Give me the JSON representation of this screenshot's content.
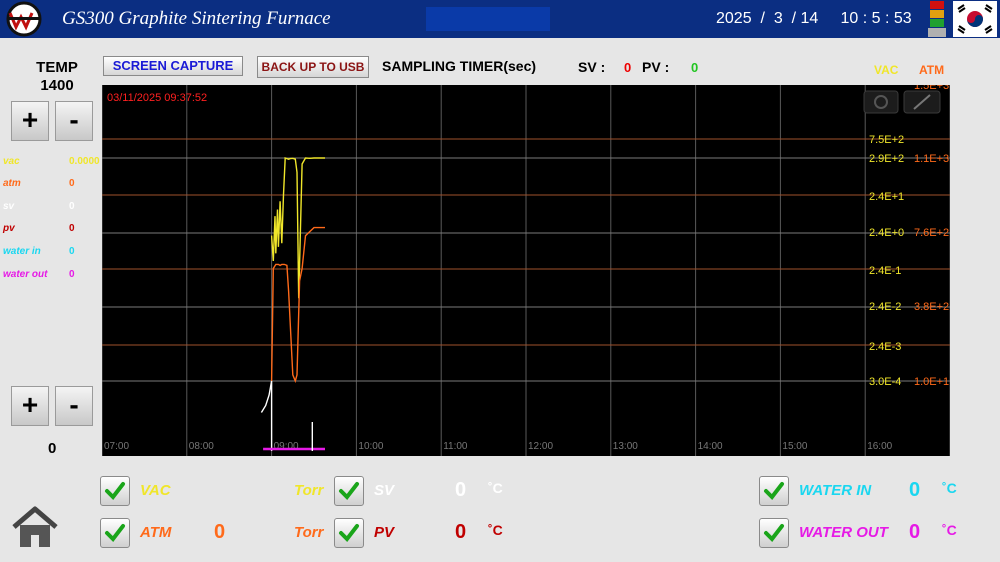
{
  "header": {
    "title": "GS300 Graphite Sintering Furnace",
    "clock": "2025  /  3  / 14     10 : 5 : 53",
    "logo_icon": "company-logo",
    "flag_icon": "korea-flag-icon",
    "tower_icon": "signal-tower-icon"
  },
  "temp": {
    "label": "TEMP",
    "value": "1400"
  },
  "left": {
    "lower_zero": "0"
  },
  "legend": [
    {
      "label": "vac",
      "value": "0.0000",
      "color": "#f0e62a"
    },
    {
      "label": "atm",
      "value": "0",
      "color": "#ff6a1a"
    },
    {
      "label": "sv",
      "value": "0",
      "color": "#ffffff"
    },
    {
      "label": "pv",
      "value": "0",
      "color": "#c00000"
    },
    {
      "label": "water in",
      "value": "0",
      "color": "#1ad7f0"
    },
    {
      "label": "water out",
      "value": "0",
      "color": "#e61ae6"
    }
  ],
  "toolbar": {
    "capture_label": "SCREEN CAPTURE",
    "usb_label": "BACK UP TO USB",
    "sampling_label": "SAMPLING TIMER(sec)",
    "sv_label": "SV :",
    "sv_value": "0",
    "pv_label": "PV :",
    "pv_value": "0",
    "vac_head": "VAC",
    "atm_head": "ATM"
  },
  "chart_data": {
    "type": "line",
    "timestamp": "03/11/2025 09:37:52",
    "x_ticks": [
      "07:00",
      "08:00",
      "09:00",
      "10:00",
      "11:00",
      "12:00",
      "13:00",
      "14:00",
      "15:00",
      "16:00"
    ],
    "vac_ticks": [
      "7.5E+2",
      "2.9E+2",
      "2.4E+1",
      "2.4E+0",
      "2.4E-1",
      "2.4E-2",
      "2.4E-3",
      "3.0E-4"
    ],
    "atm_ticks": [
      "1.5E+3",
      "1.1E+3",
      "7.6E+2",
      "3.8E+2",
      "1.0E+1"
    ],
    "series": [
      {
        "name": "vac",
        "color": "#f0e62a",
        "x": [
          9.0,
          9.02,
          9.04,
          9.05,
          9.07,
          9.08,
          9.1,
          9.12,
          9.14,
          9.16,
          9.18,
          9.2,
          9.22,
          9.25,
          9.28,
          9.3,
          9.32,
          9.36,
          9.4,
          9.45,
          9.5,
          9.55,
          9.6,
          9.63
        ],
        "y": [
          2.4,
          0.5,
          8,
          0.8,
          12,
          1.2,
          20,
          1.5,
          30,
          290,
          280,
          270,
          280,
          285,
          270,
          120,
          0.05,
          200,
          290,
          285,
          290,
          290,
          290,
          290
        ]
      },
      {
        "name": "atm",
        "color": "#ff6a1a",
        "x": [
          9.0,
          9.02,
          9.05,
          9.08,
          9.1,
          9.12,
          9.15,
          9.18,
          9.2,
          9.25,
          9.28,
          9.3,
          9.33,
          9.36,
          9.4,
          9.5,
          9.63
        ],
        "y": [
          10,
          560,
          580,
          580,
          575,
          580,
          580,
          575,
          450,
          40,
          10,
          40,
          500,
          560,
          720,
          760,
          760
        ]
      },
      {
        "name": "sv",
        "color": "#ffffff",
        "x": [
          8.88,
          8.93,
          8.97,
          9.0,
          9.0
        ],
        "y": [
          110,
          130,
          160,
          200,
          0
        ]
      },
      {
        "name": "pv",
        "color": "#c00000",
        "x": [],
        "y": []
      },
      {
        "name": "water in",
        "color": "#1ad7f0",
        "x": [],
        "y": []
      },
      {
        "name": "water out",
        "color": "#e61ae6",
        "x": [
          8.9,
          9.63
        ],
        "y": [
          0,
          0
        ]
      }
    ],
    "xlim": [
      "07:00",
      "17:00"
    ],
    "grid": true
  },
  "bottom": {
    "vac_label": "VAC",
    "vac_unit": "Torr",
    "atm_label": "ATM",
    "atm_value": "0",
    "atm_unit": "Torr",
    "sv_label": "SV",
    "sv_value": "0",
    "sv_unit": "˚C",
    "pv_label": "PV",
    "pv_value": "0",
    "pv_unit": "˚C",
    "water_in_label": "WATER IN",
    "water_in_value": "0",
    "water_in_unit": "˚C",
    "water_out_label": "WATER OUT",
    "water_out_value": "0",
    "water_out_unit": "˚C"
  }
}
